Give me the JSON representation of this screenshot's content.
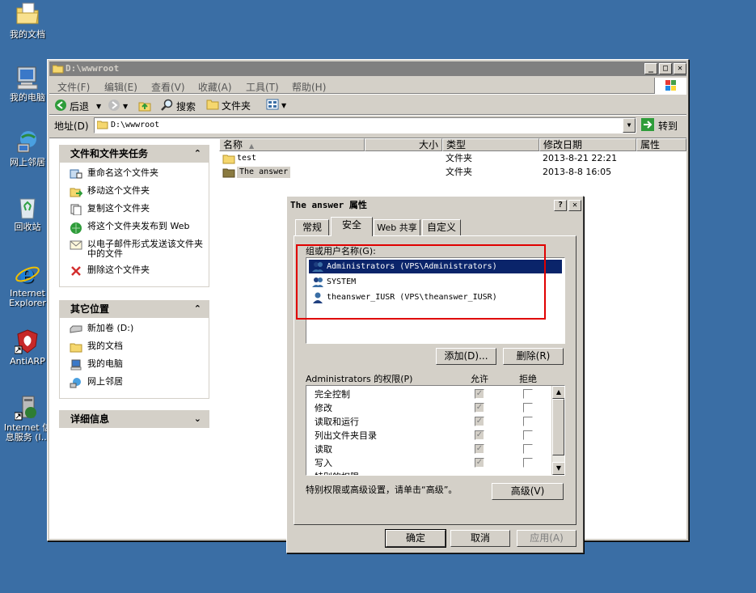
{
  "desktop": {
    "icons": [
      {
        "label": "我的文档",
        "icon": "folder-documents-icon"
      },
      {
        "label": "我的电脑",
        "icon": "computer-icon"
      },
      {
        "label": "网上邻居",
        "icon": "network-icon"
      },
      {
        "label": "回收站",
        "icon": "recycle-bin-icon"
      },
      {
        "label": "Internet Explorer",
        "icon": "ie-icon"
      },
      {
        "label": "AntiARP",
        "icon": "antiarp-icon"
      },
      {
        "label": "Internet 信息服务 (I...",
        "icon": "iis-icon"
      }
    ]
  },
  "explorer": {
    "title": "D:\\wwwroot",
    "menu": [
      "文件(F)",
      "编辑(E)",
      "查看(V)",
      "收藏(A)",
      "工具(T)",
      "帮助(H)"
    ],
    "toolbar": {
      "back": "后退",
      "search": "搜索",
      "folders": "文件夹"
    },
    "address_label": "地址(D)",
    "address_value": "D:\\wwwroot",
    "go_label": "转到",
    "tasks": {
      "title": "文件和文件夹任务",
      "items": [
        "重命名这个文件夹",
        "移动这个文件夹",
        "复制这个文件夹",
        "将这个文件夹发布到 Web",
        "以电子邮件形式发送该文件夹中的文件",
        "删除这个文件夹"
      ]
    },
    "other_places": {
      "title": "其它位置",
      "items": [
        "新加卷 (D:)",
        "我的文档",
        "我的电脑",
        "网上邻居"
      ]
    },
    "details": {
      "title": "详细信息"
    },
    "columns": [
      "名称",
      "大小",
      "类型",
      "修改日期",
      "属性"
    ],
    "files": [
      {
        "name": "test",
        "type": "文件夹",
        "date": "2013-8-21 22:21"
      },
      {
        "name": "The answer",
        "type": "文件夹",
        "date": "2013-8-8 16:05"
      }
    ]
  },
  "dialog": {
    "title": "The answer 属性",
    "tabs": [
      "常规",
      "安全",
      "Web 共享",
      "自定义"
    ],
    "group_label": "组或用户名称(G):",
    "users": [
      "Administrators (VPS\\Administrators)",
      "SYSTEM",
      "theanswer_IUSR (VPS\\theanswer_IUSR)"
    ],
    "add_button": "添加(D)...",
    "remove_button": "删除(R)",
    "perm_label": "Administrators 的权限(P)",
    "allow_label": "允许",
    "deny_label": "拒绝",
    "permissions": [
      {
        "name": "完全控制",
        "allow": true,
        "deny": false
      },
      {
        "name": "修改",
        "allow": true,
        "deny": false
      },
      {
        "name": "读取和运行",
        "allow": true,
        "deny": false
      },
      {
        "name": "列出文件夹目录",
        "allow": true,
        "deny": false
      },
      {
        "name": "读取",
        "allow": true,
        "deny": false
      },
      {
        "name": "写入",
        "allow": true,
        "deny": false
      },
      {
        "name": "特别的权限",
        "allow": false,
        "deny": false
      }
    ],
    "advanced_text": "特别权限或高级设置，请单击“高级”。",
    "advanced_button": "高级(V)",
    "ok_button": "确定",
    "cancel_button": "取消",
    "apply_button": "应用(A)",
    "highlight_color": "#e00000"
  }
}
